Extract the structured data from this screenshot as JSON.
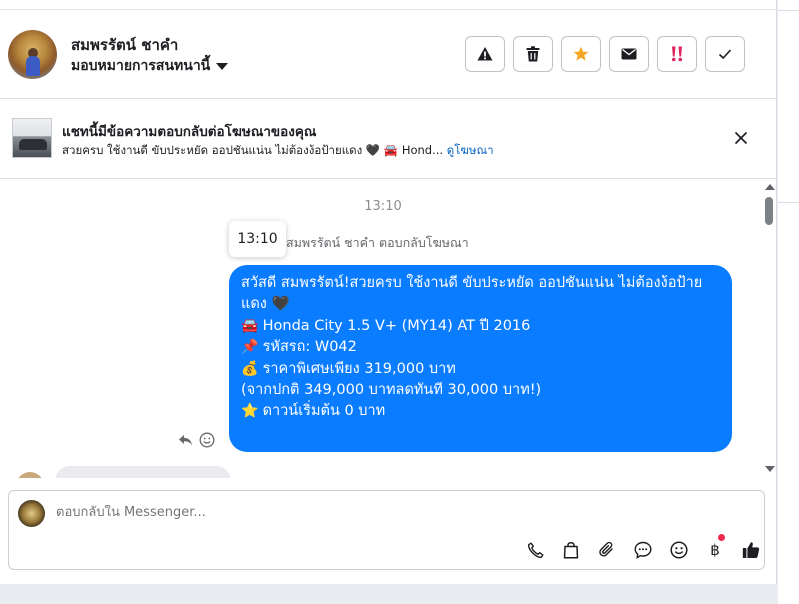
{
  "header": {
    "contact_name": "สมพรรัตน์ ชาคำ",
    "assign_label": "มอบหมายการสนทนานี้",
    "actions": [
      {
        "name": "spam-button",
        "icon": "warning-icon"
      },
      {
        "name": "delete-button",
        "icon": "trash-icon"
      },
      {
        "name": "star-button",
        "icon": "star-icon",
        "color": "#f5a623"
      },
      {
        "name": "mark-unread-button",
        "icon": "envelope-icon"
      },
      {
        "name": "follow-up-button",
        "icon": "double-exclamation-icon",
        "color": "#e0245e"
      },
      {
        "name": "mark-done-button",
        "icon": "check-icon"
      }
    ]
  },
  "ad_banner": {
    "title": "แชทนี้มีข้อความตอบกลับต่อโฆษณาของคุณ",
    "subtitle": "สวยครบ ใช้งานดี ขับประหยัด ออปชันแน่น ไม่ต้องง้อป้ายแดง 🖤 🚘 Hond...",
    "link_label": "ดูโฆษณา"
  },
  "chat": {
    "timestamp": "13:10",
    "tooltip_time": "13:10",
    "reply_note": "สมพรรัตน์ ชาคำ ตอบกลับโฆษณา",
    "message_lines": [
      {
        "emoji": "",
        "text": "สวัสดี สมพรรัตน์!สวยครบ ใช้งานดี ขับประหยัด ออปชันแน่น ไม่ต้องง้อป้าย"
      },
      {
        "emoji": "",
        "text": "แดง 🖤"
      },
      {
        "emoji": "🚘",
        "text": " Honda City 1.5 V+ (MY14) AT ปี 2016"
      },
      {
        "emoji": "",
        "text": " "
      },
      {
        "emoji": "📌",
        "text": " รหัสรถ: W042"
      },
      {
        "emoji": "💰",
        "text": " ราคาพิเศษเพียง 319,000 บาท"
      },
      {
        "emoji": "",
        "text": "(จากปกติ 349,000 บาทลดทันที 30,000 บาท!)"
      },
      {
        "emoji": "⭐",
        "text": " ดาวน์เริ่มต้น 0 บาท"
      }
    ],
    "bubble_color": "#0a7cff"
  },
  "composer": {
    "placeholder": "ตอบกลับใน Messenger...",
    "tools": [
      "phone-icon",
      "shopping-bag-icon",
      "paperclip-icon",
      "chat-bubble-icon",
      "smiley-icon",
      "baht-icon",
      "thumbs-up-icon"
    ],
    "baht_symbol": "฿"
  }
}
